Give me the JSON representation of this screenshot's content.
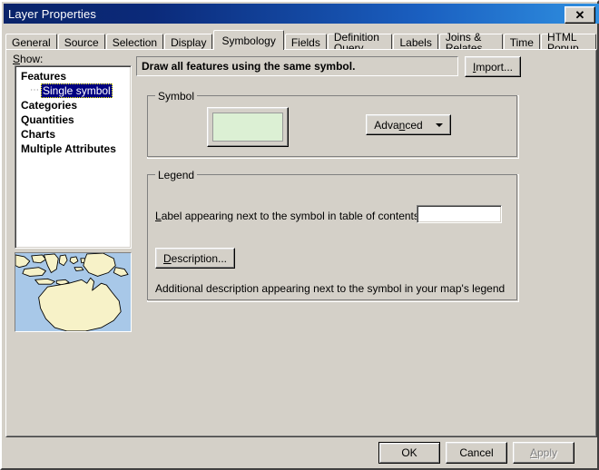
{
  "window": {
    "title": "Layer Properties",
    "close_label": "✕"
  },
  "tabs": [
    {
      "label": "General",
      "active": false
    },
    {
      "label": "Source",
      "active": false
    },
    {
      "label": "Selection",
      "active": false
    },
    {
      "label": "Display",
      "active": false
    },
    {
      "label": "Symbology",
      "active": true
    },
    {
      "label": "Fields",
      "active": false
    },
    {
      "label": "Definition Query",
      "active": false
    },
    {
      "label": "Labels",
      "active": false
    },
    {
      "label": "Joins & Relates",
      "active": false
    },
    {
      "label": "Time",
      "active": false
    },
    {
      "label": "HTML Popup",
      "active": false
    }
  ],
  "show": {
    "label": "Show:",
    "label_accel": "S",
    "label_rest": "how:",
    "items": [
      {
        "label": "Features",
        "bold": true,
        "selected": false,
        "child": false
      },
      {
        "label": "Single symbol",
        "bold": false,
        "selected": true,
        "child": true
      },
      {
        "label": "Categories",
        "bold": true,
        "selected": false,
        "child": false
      },
      {
        "label": "Quantities",
        "bold": true,
        "selected": false,
        "child": false
      },
      {
        "label": "Charts",
        "bold": true,
        "selected": false,
        "child": false
      },
      {
        "label": "Multiple Attributes",
        "bold": true,
        "selected": false,
        "child": false
      }
    ]
  },
  "thumbnail": {
    "name": "map-preview",
    "ocean_color": "#a8c8e8",
    "land_color": "#f7f2c8",
    "outline_color": "#000000"
  },
  "header": {
    "text": "Draw all features using the same symbol.",
    "import_accel": "I",
    "import_rest": "mport..."
  },
  "symbol_group": {
    "title": "Symbol",
    "swatch_fill": "#dcf0d4",
    "swatch_outline": "#9a9a9a",
    "advanced_pre": "Adva",
    "advanced_accel": "n",
    "advanced_post": "ced"
  },
  "legend_group": {
    "title": "Legend",
    "label_accel": "L",
    "label_rest": "abel appearing next to the symbol in table of contents:",
    "label_value": "",
    "label_placeholder": "",
    "description_accel": "D",
    "description_rest": "escription...",
    "description_note": "Additional description appearing next to the symbol in your map's legend"
  },
  "footer": {
    "ok_label": "OK",
    "cancel_label": "Cancel",
    "apply_accel": "A",
    "apply_rest": "pply",
    "apply_disabled": true
  }
}
